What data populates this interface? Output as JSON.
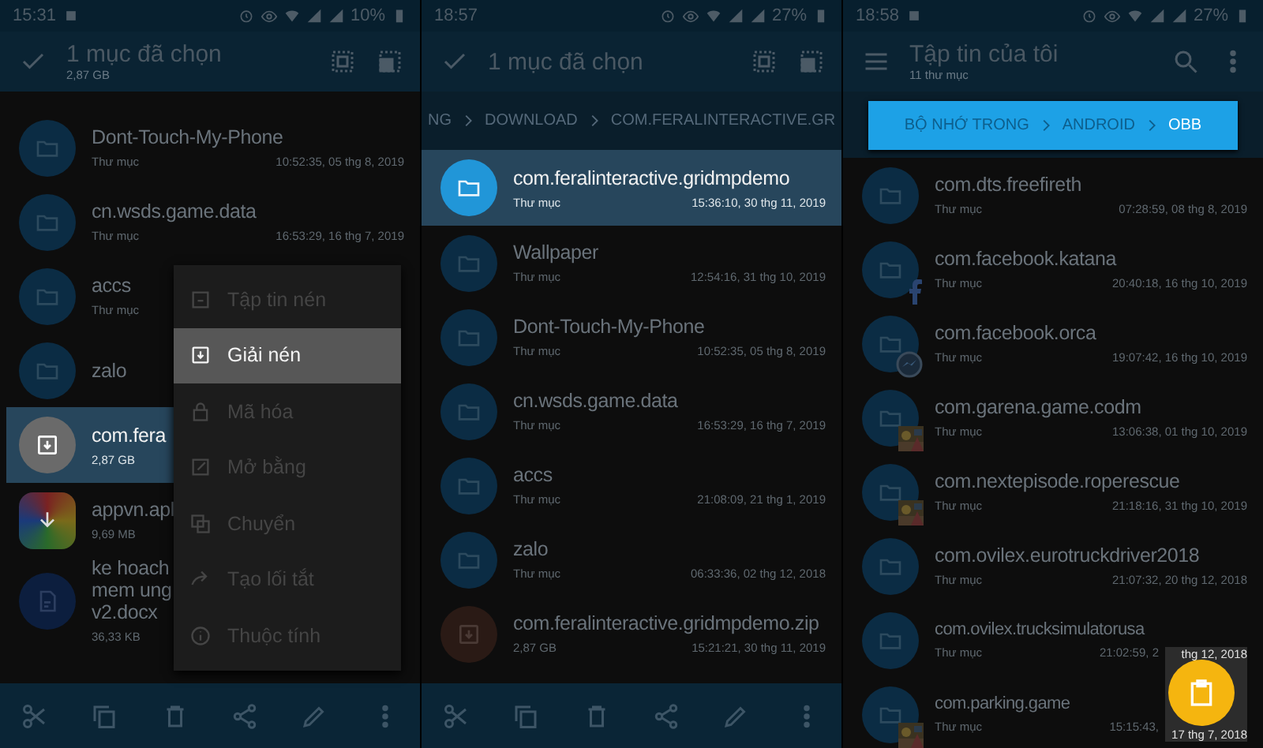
{
  "panels": [
    {
      "status_bar": {
        "time": "15:31",
        "battery": "10%",
        "notification": true
      },
      "app_bar": {
        "kind": "selection",
        "title": "1 mục đã chọn",
        "subtitle": "2,87 GB"
      },
      "rows": [
        {
          "kind": "folder",
          "name": "Dont-Touch-My-Phone",
          "detail": "Thư mục",
          "date": "10:52:35, 05 thg 8, 2019",
          "selected": false
        },
        {
          "kind": "folder",
          "name": "cn.wsds.game.data",
          "detail": "Thư mục",
          "date": "16:53:29, 16 thg 7, 2019",
          "selected": false
        },
        {
          "kind": "folder",
          "name": "accs",
          "detail": "Thư mục",
          "selected": false
        },
        {
          "kind": "folder",
          "name": "zalo",
          "selected": false
        },
        {
          "kind": "archive",
          "name": "com.fera",
          "detail": "2,87 GB",
          "selected": true
        },
        {
          "kind": "app",
          "name": "appvn.apl",
          "detail": "9,69 MB",
          "selected": false
        },
        {
          "kind": "document",
          "name": "ke hoach\nmem ung\nv2.docx",
          "detail": "36,33 KB",
          "selected": false
        }
      ],
      "menu": {
        "items": [
          {
            "kind": "archive",
            "label": "Tập tin nén",
            "selected": false
          },
          {
            "kind": "extract",
            "label": "Giải nén",
            "selected": true
          },
          {
            "kind": "lock",
            "label": "Mã hóa",
            "selected": false
          },
          {
            "kind": "open",
            "label": "Mở bằng",
            "selected": false
          },
          {
            "kind": "move",
            "label": "Chuyển",
            "selected": false
          },
          {
            "kind": "shortcut",
            "label": "Tạo lối tắt",
            "selected": false
          },
          {
            "kind": "info",
            "label": "Thuộc tính",
            "selected": false
          }
        ]
      },
      "bottom_toolbar": true
    },
    {
      "status_bar": {
        "time": "18:57",
        "battery": "27%",
        "notification": false
      },
      "app_bar": {
        "kind": "selection",
        "title": "1 mục đã chọn"
      },
      "breadcrumb": {
        "highlighted": false,
        "crumbs": [
          {
            "label": "NG",
            "selected": false
          },
          {
            "label": "DOWNLOAD",
            "selected": false
          },
          {
            "label": "COM.FERALINTERACTIVE.GR",
            "selected": false
          }
        ]
      },
      "rows": [
        {
          "kind": "folder",
          "name": "com.feralinteractive.gridmpdemo",
          "detail": "Thư mục",
          "date": "15:36:10, 30 thg 11, 2019",
          "selected": true
        },
        {
          "kind": "folder",
          "name": "Wallpaper",
          "detail": "Thư mục",
          "date": "12:54:16, 31 thg 10, 2019",
          "selected": false
        },
        {
          "kind": "folder",
          "name": "Dont-Touch-My-Phone",
          "detail": "Thư mục",
          "date": "10:52:35, 05 thg 8, 2019",
          "selected": false
        },
        {
          "kind": "folder",
          "name": "cn.wsds.game.data",
          "detail": "Thư mục",
          "date": "16:53:29, 16 thg 7, 2019",
          "selected": false
        },
        {
          "kind": "folder",
          "name": "accs",
          "detail": "Thư mục",
          "date": "21:08:09, 21 thg 1, 2019",
          "selected": false
        },
        {
          "kind": "folder",
          "name": "zalo",
          "detail": "Thư mục",
          "date": "06:33:36, 02 thg 12, 2018",
          "selected": false
        },
        {
          "kind": "zip",
          "name": "com.feralinteractive.gridmpdemo.zip",
          "detail": "2,87 GB",
          "date": "15:21:21, 30 thg 11, 2019",
          "selected": false
        }
      ],
      "bottom_toolbar": true
    },
    {
      "status_bar": {
        "time": "18:58",
        "battery": "27%",
        "notification": true
      },
      "app_bar": {
        "kind": "browse",
        "title": "Tập tin của tôi",
        "subtitle": "11 thư mục"
      },
      "breadcrumb": {
        "highlighted": true,
        "crumbs": [
          {
            "label": "BỘ NHỚ TRONG",
            "selected": false
          },
          {
            "label": "ANDROID",
            "selected": false
          },
          {
            "label": "OBB",
            "selected": true
          }
        ]
      },
      "rows": [
        {
          "kind": "folder",
          "name": "com.dts.freefireth",
          "detail": "Thư mục",
          "date": "07:28:59, 08 thg 8, 2019",
          "selected": false
        },
        {
          "kind": "facebook",
          "name": "com.facebook.katana",
          "detail": "Thư mục",
          "date": "20:40:18, 16 thg 10, 2019",
          "selected": false
        },
        {
          "kind": "messenger",
          "name": "com.facebook.orca",
          "detail": "Thư mục",
          "date": "19:07:42, 16 thg 10, 2019",
          "selected": false
        },
        {
          "kind": "game",
          "name": "com.garena.game.codm",
          "detail": "Thư mục",
          "date": "13:06:38, 01 thg 10, 2019",
          "selected": false
        },
        {
          "kind": "game",
          "name": "com.nextepisode.roperescue",
          "detail": "Thư mục",
          "date": "21:18:16, 31 thg 10, 2019",
          "selected": false
        },
        {
          "kind": "folder",
          "name": "com.ovilex.eurotruckdriver2018",
          "detail": "Thư mục",
          "date": "21:07:32, 20 thg 12, 2018",
          "selected": false
        },
        {
          "kind": "folder",
          "name": "com.ovilex.trucksimulatorusa",
          "detail": "Thư mục",
          "date": "21:02:59, 2",
          "selected": false
        },
        {
          "kind": "game",
          "name": "com.parking.game",
          "detail": "Thư mục",
          "date": "15:15:43,",
          "selected": false
        }
      ],
      "fab": {
        "texts": [
          "thg 12, 2018",
          "17 thg 7, 2018"
        ]
      }
    }
  ]
}
